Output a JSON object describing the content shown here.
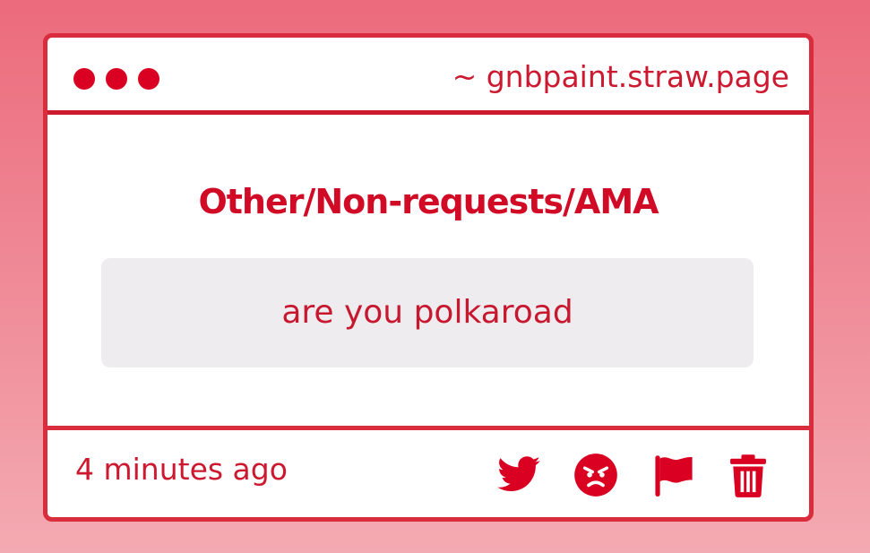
{
  "window": {
    "url": "~ gnbpaint.straw.page"
  },
  "post": {
    "category": "Other/Non-requests/AMA",
    "message": "are you polkaroad"
  },
  "footer": {
    "timestamp": "4 minutes ago",
    "actions": [
      "twitter-icon",
      "angry-face-icon",
      "flag-icon",
      "trash-icon"
    ]
  },
  "colors": {
    "accent": "#d90021",
    "border": "#d92d3e",
    "message_bg": "#eeecee",
    "background_top": "#ec6b7c",
    "background_bottom": "#f4aab2"
  }
}
